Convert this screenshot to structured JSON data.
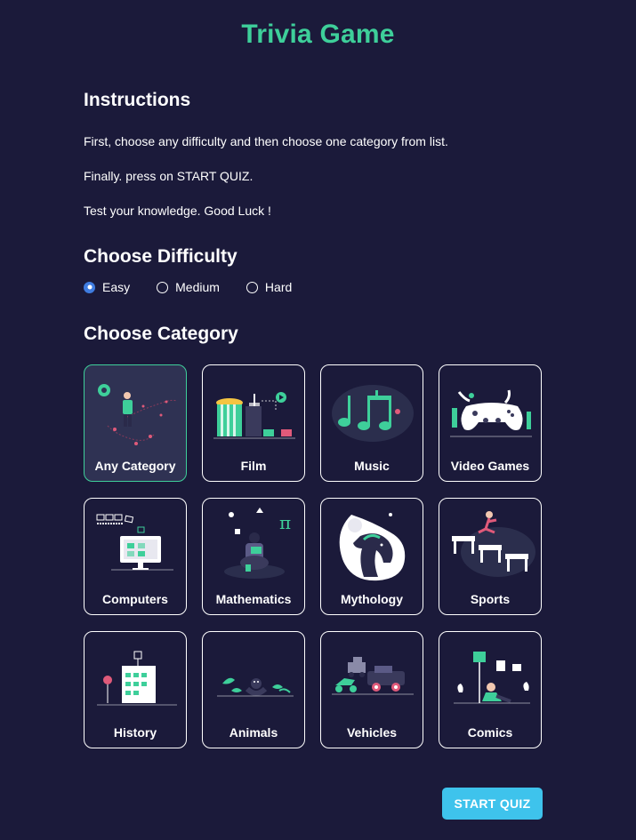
{
  "title": "Trivia Game",
  "instructions": {
    "heading": "Instructions",
    "lines": [
      "First, choose any difficulty and then choose one category from list.",
      "Finally. press on START QUIZ.",
      "Test your knowledge. Good Luck !"
    ]
  },
  "difficulty": {
    "heading": "Choose Difficulty",
    "options": [
      "Easy",
      "Medium",
      "Hard"
    ],
    "selected": "Easy"
  },
  "category": {
    "heading": "Choose Category",
    "items": [
      {
        "label": "Any Category",
        "icon": "astronaut-icon",
        "selected": true
      },
      {
        "label": "Film",
        "icon": "popcorn-icon",
        "selected": false
      },
      {
        "label": "Music",
        "icon": "music-notes-icon",
        "selected": false
      },
      {
        "label": "Video Games",
        "icon": "game-controller-icon",
        "selected": false
      },
      {
        "label": "Computers",
        "icon": "computer-icon",
        "selected": false
      },
      {
        "label": "Mathematics",
        "icon": "pi-reader-icon",
        "selected": false
      },
      {
        "label": "Mythology",
        "icon": "horse-head-icon",
        "selected": false
      },
      {
        "label": "Sports",
        "icon": "hurdles-icon",
        "selected": false
      },
      {
        "label": "History",
        "icon": "building-icon",
        "selected": false
      },
      {
        "label": "Animals",
        "icon": "animal-icon",
        "selected": false
      },
      {
        "label": "Vehicles",
        "icon": "vehicles-icon",
        "selected": false
      },
      {
        "label": "Comics",
        "icon": "comics-lamp-icon",
        "selected": false
      }
    ]
  },
  "start_button": "START QUIZ",
  "colors": {
    "background": "#1b1a3a",
    "accent": "#3ecf9a",
    "button": "#3ec3ec",
    "radio": "#3f7ce0"
  }
}
